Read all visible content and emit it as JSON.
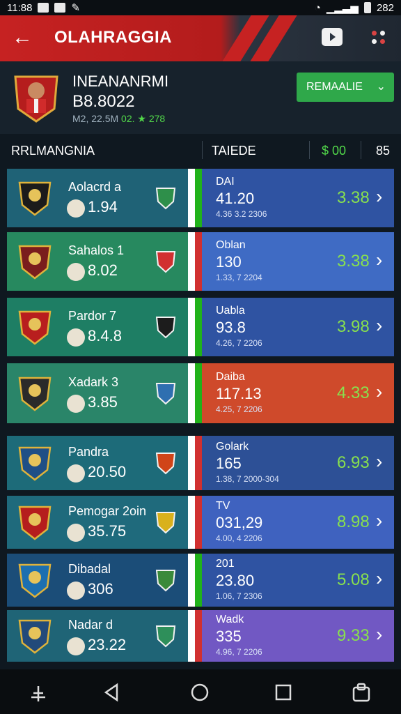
{
  "status": {
    "time": "11:88",
    "battery": "282"
  },
  "appbar": {
    "back_glyph": "←",
    "title": "OLAHRAGGIA"
  },
  "profile": {
    "name": "INEANANRMI",
    "number": "B8.8022",
    "sub_stats": "M2, 22.5M",
    "sub_change": "02. ★ 278",
    "button_label": "REMAALIE",
    "button_glyph": "⌄"
  },
  "columns": {
    "left": "RRLMANGNIA",
    "mid": "TAIEDE",
    "money": "$ 00",
    "last": "85"
  },
  "rows": [
    {
      "name": "Aolacrd a",
      "score": "1.94",
      "right_name": "DAI",
      "right_value": "41.20",
      "right_sub": "4.36 3.2 2306",
      "odds": "3.38"
    },
    {
      "name": "Sahalos 1",
      "score": "8.02",
      "right_name": "Oblan",
      "right_value": "130",
      "right_sub": "1.33, 7 2204",
      "odds": "3.38"
    },
    {
      "name": "Pardor 7",
      "score": "8.4.8",
      "right_name": "Uabla",
      "right_value": "93.8",
      "right_sub": "4.26, 7 2206",
      "odds": "3.98"
    },
    {
      "name": "Xadark 3",
      "score": "3.85",
      "right_name": "Daiba",
      "right_value": "117.13",
      "right_sub": "4.25, 7 2206",
      "odds": "4.33"
    },
    {
      "name": "Pandra",
      "score": "20.50",
      "right_name": "Golark",
      "right_value": "165",
      "right_sub": "1.38, 7 2000-304",
      "odds": "6.93"
    },
    {
      "name": "Pemogar 2oin",
      "score": "35.75",
      "right_name": "TV",
      "right_value": "031,29",
      "right_sub": "4.00, 4 2206",
      "odds": "8.98"
    },
    {
      "name": "Dibadal",
      "score": "306",
      "right_name": "201",
      "right_value": "23.80",
      "right_sub": "1.06, 7 2306",
      "odds": "5.08"
    },
    {
      "name": "Nadar d",
      "score": "23.22",
      "right_name": "Wadk",
      "right_value": "335",
      "right_sub": "4.96, 7 2206",
      "odds": "9.33"
    }
  ],
  "colors": {
    "accent_red": "#c62222",
    "green": "#2fa84a",
    "odds_green": "#88e04e"
  }
}
